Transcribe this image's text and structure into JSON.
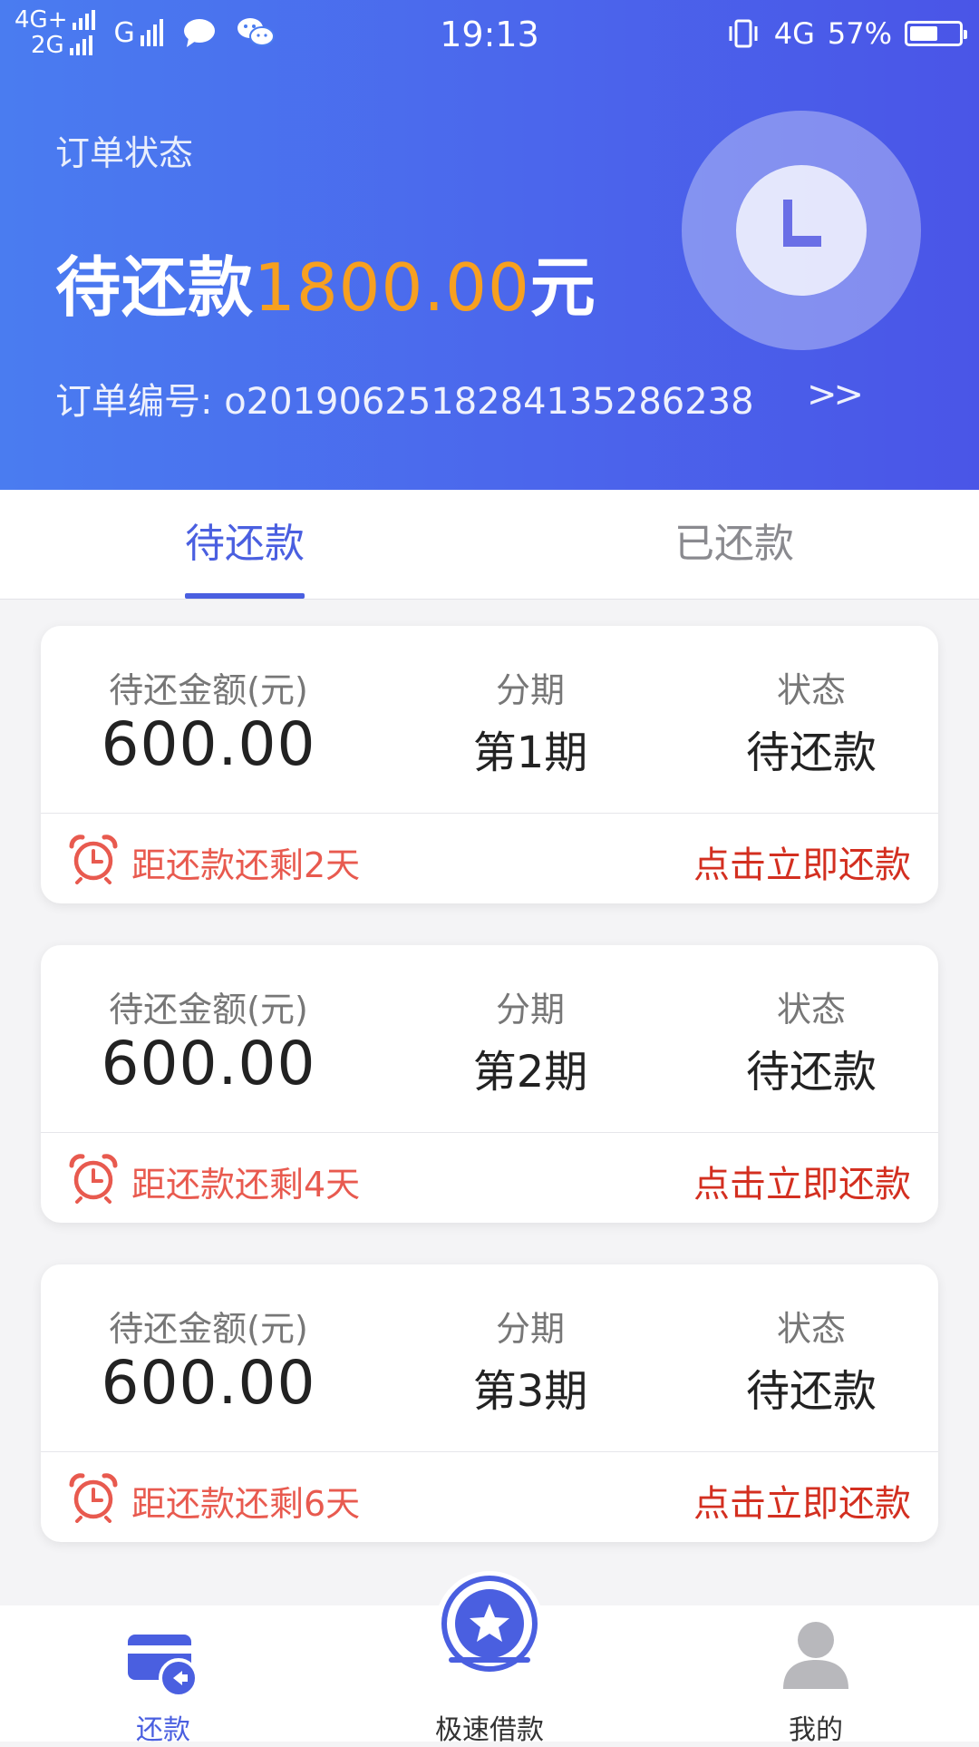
{
  "status_bar": {
    "net1": "4G+",
    "net2": "2G",
    "net3": "G",
    "time": "19:13",
    "net_right": "4G",
    "battery": "57%",
    "battery_level": 0.57
  },
  "header": {
    "order_status_label": "订单状态",
    "amount_prefix": "待还款",
    "amount_value": "1800.00",
    "amount_suffix": "元",
    "order_no_label": "订单编号:",
    "order_no": "o2019062518284135286238",
    "chevron": ">>"
  },
  "tabs": [
    {
      "label": "待还款",
      "active": true
    },
    {
      "label": "已还款",
      "active": false
    }
  ],
  "card_headers": {
    "amount": "待还金额(元)",
    "period": "分期",
    "status": "状态"
  },
  "installments": [
    {
      "amount": "600.00",
      "period": "第1期",
      "status": "待还款",
      "countdown": "距还款还剩2天",
      "action": "点击立即还款"
    },
    {
      "amount": "600.00",
      "period": "第2期",
      "status": "待还款",
      "countdown": "距还款还剩4天",
      "action": "点击立即还款"
    },
    {
      "amount": "600.00",
      "period": "第3期",
      "status": "待还款",
      "countdown": "距还款还剩6天",
      "action": "点击立即还款"
    }
  ],
  "bottom_nav": [
    {
      "label": "还款",
      "icon": "card-repay-icon",
      "active": true
    },
    {
      "label": "极速借款",
      "icon": "star-badge-icon",
      "active": false
    },
    {
      "label": "我的",
      "icon": "user-icon",
      "active": false
    }
  ],
  "colors": {
    "brand": "#4a5fe0",
    "amount_highlight": "#f7a020",
    "countdown": "#e85a4f",
    "pay_now": "#d32f20"
  }
}
